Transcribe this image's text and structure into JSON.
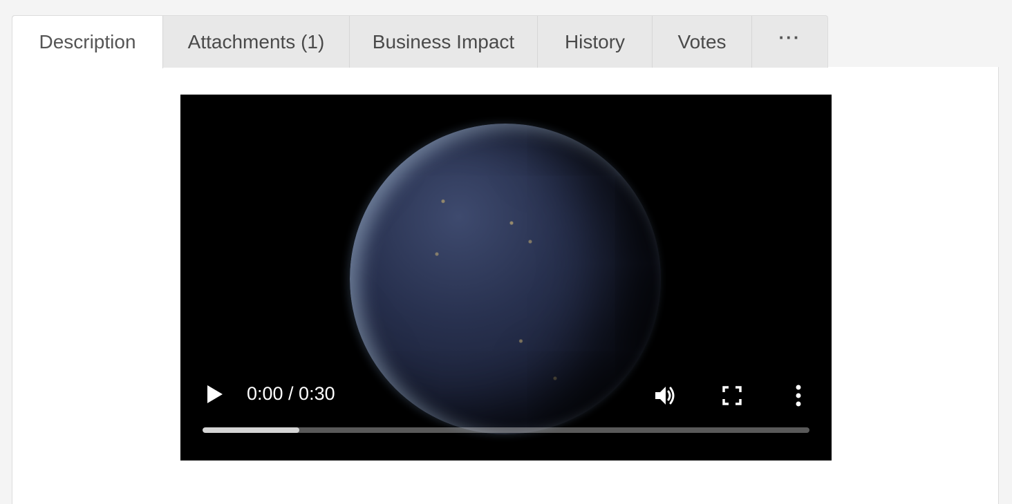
{
  "tabs": [
    {
      "label": "Description",
      "active": true
    },
    {
      "label": "Attachments (1)",
      "active": false
    },
    {
      "label": "Business Impact",
      "active": false
    },
    {
      "label": "History",
      "active": false
    },
    {
      "label": "Votes",
      "active": false
    },
    {
      "label": "···",
      "active": false
    }
  ],
  "video": {
    "current_time": "0:00",
    "duration": "0:30",
    "time_display": "0:00 / 0:30",
    "buffered_fraction": 0.16,
    "icons": {
      "play": "play-icon",
      "volume": "volume-icon",
      "fullscreen": "fullscreen-icon",
      "menu": "more-vertical-icon"
    }
  },
  "colors": {
    "page_bg": "#f4f4f4",
    "tab_bg": "#e8e8e8",
    "active_tab_bg": "#ffffff",
    "video_bg": "#000000"
  }
}
